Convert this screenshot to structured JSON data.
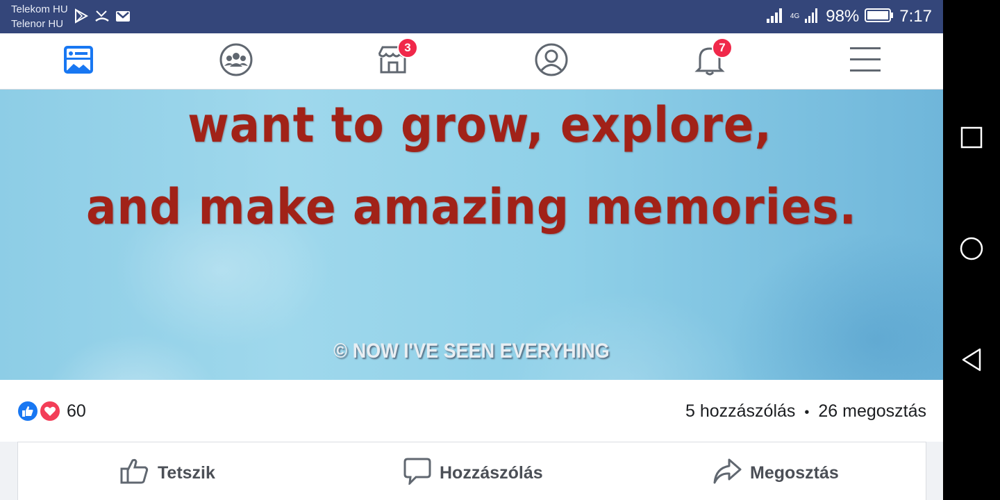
{
  "status_bar": {
    "carrier_1": "Telekom HU",
    "carrier_2": "Telenor HU",
    "network": "4G",
    "battery": "98%",
    "time": "7:17"
  },
  "nav": {
    "marketplace_badge": "3",
    "notifications_badge": "7",
    "icons": [
      "news-feed-icon",
      "groups-icon",
      "marketplace-icon",
      "profile-icon",
      "notifications-icon",
      "menu-icon"
    ]
  },
  "post": {
    "quote_line_1": "want to grow, explore,",
    "quote_line_2": "and make amazing memories.",
    "credit": "© NOW I'VE SEEN EVERYHING"
  },
  "reactions": {
    "count": "60",
    "comments": "5 hozzászólás",
    "separator": "•",
    "shares": "26 megosztás"
  },
  "actions": {
    "like": "Tetszik",
    "comment": "Hozzászólás",
    "share": "Megosztás"
  },
  "colors": {
    "status_bar": "#34467a",
    "brand_blue": "#1877f2",
    "badge_red": "#f0284a",
    "quote_red": "#a12218"
  }
}
